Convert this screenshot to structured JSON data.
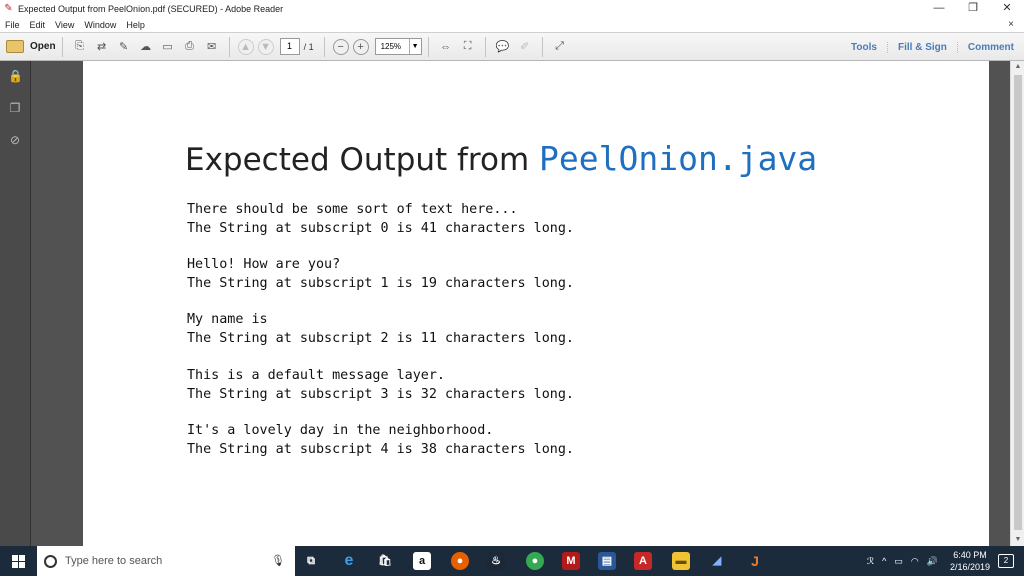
{
  "window": {
    "title": "Expected Output from PeelOnion.pdf (SECURED) - Adobe Reader",
    "minimize": "—",
    "restore": "❐",
    "close": "✕"
  },
  "menu": {
    "items": [
      "File",
      "Edit",
      "View",
      "Window",
      "Help"
    ],
    "close": "×"
  },
  "toolbar": {
    "open_label": "Open",
    "page_current": "1",
    "page_total": "/ 1",
    "zoom": "125%",
    "right_links": [
      "Tools",
      "Fill & Sign",
      "Comment"
    ]
  },
  "document": {
    "title_plain": "Expected Output from ",
    "title_code": "PeelOnion.java",
    "blocks": [
      [
        "There should be some sort of text here...",
        "The String at subscript 0 is 41 characters long."
      ],
      [
        "Hello! How are you?",
        "The String at subscript 1 is 19 characters long."
      ],
      [
        "My name is",
        "The String at subscript 2 is 11 characters long."
      ],
      [
        "This is a default message layer.",
        "The String at subscript 3 is 32 characters long."
      ],
      [
        "It's a lovely day in the neighborhood.",
        "The String at subscript 4 is 38 characters long."
      ]
    ]
  },
  "taskbar": {
    "search_placeholder": "Type here to search",
    "tray_text": "^",
    "time": "6:40 PM",
    "date": "2/16/2019",
    "notification_count": "2"
  },
  "colors": {
    "code_blue": "#1f6fc0",
    "link_blue": "#4a7cb8",
    "taskbar": "#1c2b3c"
  }
}
